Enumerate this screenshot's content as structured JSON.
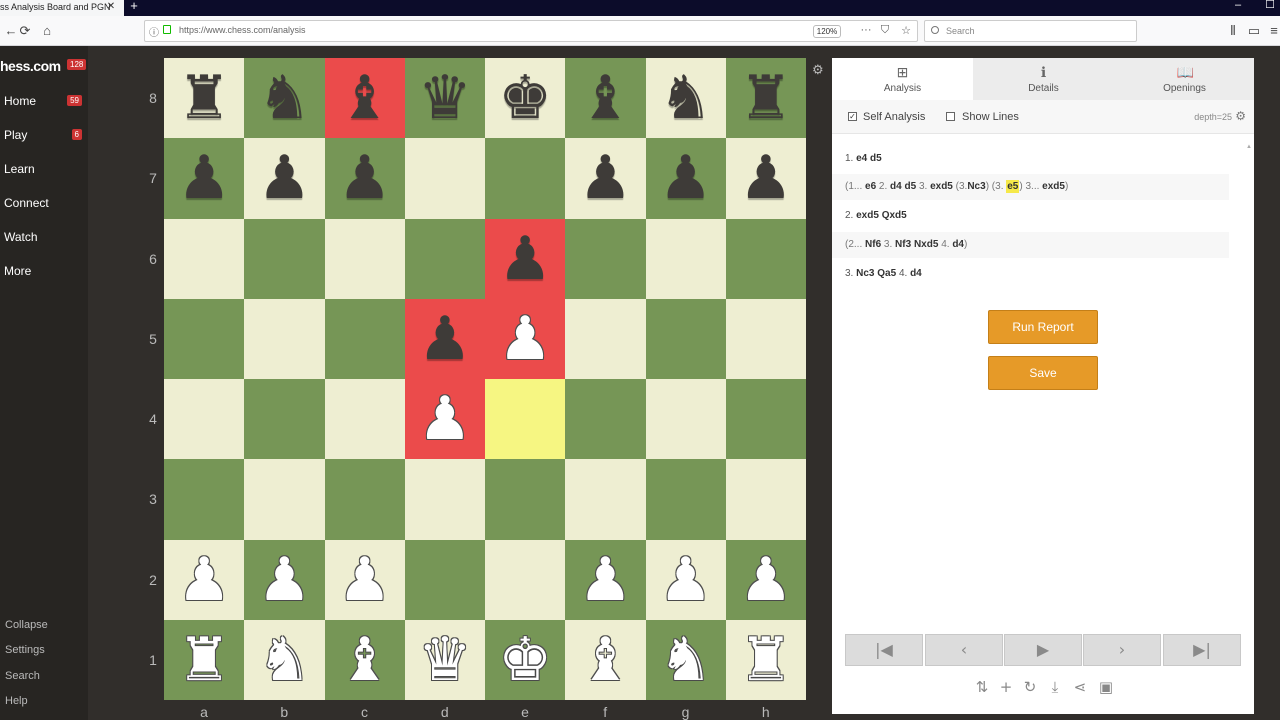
{
  "browser": {
    "tab_title": "ss Analysis Board and PGN",
    "tab_close": "✕",
    "new_tab": "+",
    "url": "https://www.chess.com/analysis",
    "zoom": "120%",
    "search_placeholder": "Search",
    "back_icon": "←",
    "reload_icon": "⟳",
    "home_icon": "⌂",
    "info_icon": "ⓘ",
    "menu_icon": "···",
    "pocket_icon": "⛉",
    "star_icon": "☆",
    "library_icon": "⦀",
    "sidebar_icon": "▭",
    "menu_more": "≡",
    "minimize": "–",
    "maximize": "☐",
    "close": "✕"
  },
  "sidebar": {
    "logo": "hess.com",
    "logo_badge": "128",
    "items": [
      {
        "label": "Home",
        "badge": "59"
      },
      {
        "label": "Play",
        "badge": "6"
      },
      {
        "label": "Learn",
        "badge": ""
      },
      {
        "label": "Connect",
        "badge": ""
      },
      {
        "label": "Watch",
        "badge": ""
      },
      {
        "label": "More",
        "badge": ""
      }
    ],
    "bottom": [
      "Collapse",
      "Settings",
      "Search",
      "Help"
    ]
  },
  "board": {
    "ranks": [
      "8",
      "7",
      "6",
      "5",
      "4",
      "3",
      "2",
      "1"
    ],
    "files": [
      "a",
      "b",
      "c",
      "d",
      "e",
      "f",
      "g",
      "h"
    ],
    "highlight_red": [
      "c8",
      "e6",
      "d5",
      "e5",
      "d4"
    ],
    "highlight_yellow": [
      "e4"
    ],
    "colors": {
      "light": "#eeeed2",
      "dark": "#769656",
      "red": "#eb4b4b",
      "yellow": "#f6f682"
    },
    "pieces": {
      "a8": "r",
      "b8": "n",
      "c8": "b",
      "d8": "q",
      "e8": "k",
      "f8": "b",
      "g8": "n",
      "h8": "r",
      "a7": "p",
      "b7": "p",
      "c7": "p",
      "f7": "p",
      "g7": "p",
      "h7": "p",
      "e6": "p",
      "d5": "p",
      "e5": "P",
      "d4": "P",
      "a2": "P",
      "b2": "P",
      "c2": "P",
      "f2": "P",
      "g2": "P",
      "h2": "P",
      "a1": "R",
      "b1": "N",
      "c1": "B",
      "d1": "Q",
      "e1": "K",
      "f1": "B",
      "g1": "N",
      "h1": "R"
    },
    "gear_icon": "⚙"
  },
  "panel": {
    "tabs": [
      {
        "label": "Analysis",
        "icon": "analysis-icon",
        "glyph": "⊞",
        "active": true
      },
      {
        "label": "Details",
        "icon": "info-icon",
        "glyph": "ℹ",
        "active": false
      },
      {
        "label": "Openings",
        "icon": "book-icon",
        "glyph": "📖",
        "active": false
      }
    ],
    "self_analysis": {
      "label": "Self Analysis",
      "checked": true,
      "mark": "✓"
    },
    "show_lines": {
      "label": "Show Lines",
      "checked": false
    },
    "depth": "depth=25",
    "gear_icon": "⚙",
    "moves": {
      "line1": {
        "num": "1.",
        "w": "e4",
        "b": "d5"
      },
      "var1": {
        "p1": "(1...",
        "m1": "e6",
        "p2": "2.",
        "m2": "d4",
        "m3": "d5",
        "p3": "3.",
        "m4": "exd5",
        "p4": "(3.",
        "m5": "Nc3",
        "p5": ") (3.",
        "m6": "e5",
        "p6": ") 3...",
        "m7": "exd5",
        "p7": ")"
      },
      "line2": {
        "num": "2.",
        "w": "exd5",
        "b": "Qxd5"
      },
      "var2": {
        "p1": "(2...",
        "m1": "Nf6",
        "p2": "3.",
        "m2": "Nf3",
        "m3": "Nxd5",
        "p3": "4.",
        "m4": "d4",
        "p4": ")"
      },
      "line3": {
        "num": "3.",
        "w": "Nc3",
        "b": "Qa5",
        "num2": "4.",
        "w2": "d4"
      }
    },
    "run_report": "Run Report",
    "save": "Save",
    "controls": {
      "first": "|◀",
      "prev": "‹",
      "play": "▶",
      "next": "›",
      "last": "▶|"
    },
    "tools": {
      "flip": "⇅",
      "add": "+",
      "reset": "↻",
      "download": "⤓",
      "share": "⋖",
      "board": "▣"
    }
  }
}
